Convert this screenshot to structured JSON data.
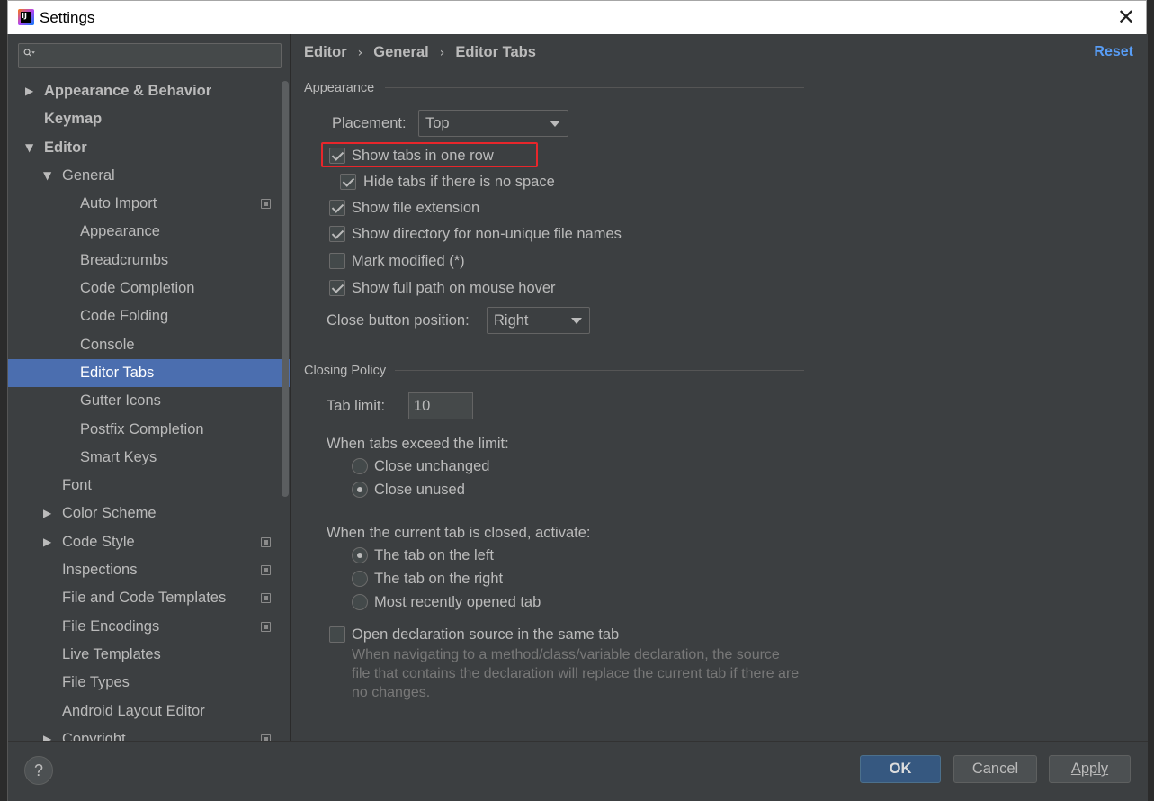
{
  "window": {
    "title": "Settings"
  },
  "search": {
    "placeholder": ""
  },
  "tree": [
    {
      "label": "Appearance & Behavior",
      "level": 0,
      "arrow": "▶",
      "bold": true,
      "selected": false,
      "project_icon": false
    },
    {
      "label": "Keymap",
      "level": 0,
      "arrow": "",
      "bold": true,
      "selected": false,
      "project_icon": false
    },
    {
      "label": "Editor",
      "level": 0,
      "arrow": "▼",
      "bold": true,
      "selected": false,
      "project_icon": false
    },
    {
      "label": "General",
      "level": 1,
      "arrow": "▼",
      "bold": false,
      "selected": false,
      "project_icon": false
    },
    {
      "label": "Auto Import",
      "level": 2,
      "arrow": "",
      "bold": false,
      "selected": false,
      "project_icon": true
    },
    {
      "label": "Appearance",
      "level": 2,
      "arrow": "",
      "bold": false,
      "selected": false,
      "project_icon": false
    },
    {
      "label": "Breadcrumbs",
      "level": 2,
      "arrow": "",
      "bold": false,
      "selected": false,
      "project_icon": false
    },
    {
      "label": "Code Completion",
      "level": 2,
      "arrow": "",
      "bold": false,
      "selected": false,
      "project_icon": false
    },
    {
      "label": "Code Folding",
      "level": 2,
      "arrow": "",
      "bold": false,
      "selected": false,
      "project_icon": false
    },
    {
      "label": "Console",
      "level": 2,
      "arrow": "",
      "bold": false,
      "selected": false,
      "project_icon": false
    },
    {
      "label": "Editor Tabs",
      "level": 2,
      "arrow": "",
      "bold": false,
      "selected": true,
      "project_icon": false
    },
    {
      "label": "Gutter Icons",
      "level": 2,
      "arrow": "",
      "bold": false,
      "selected": false,
      "project_icon": false
    },
    {
      "label": "Postfix Completion",
      "level": 2,
      "arrow": "",
      "bold": false,
      "selected": false,
      "project_icon": false
    },
    {
      "label": "Smart Keys",
      "level": 2,
      "arrow": "",
      "bold": false,
      "selected": false,
      "project_icon": false
    },
    {
      "label": "Font",
      "level": 1,
      "arrow": "",
      "bold": false,
      "selected": false,
      "project_icon": false
    },
    {
      "label": "Color Scheme",
      "level": 1,
      "arrow": "▶",
      "bold": false,
      "selected": false,
      "project_icon": false
    },
    {
      "label": "Code Style",
      "level": 1,
      "arrow": "▶",
      "bold": false,
      "selected": false,
      "project_icon": true
    },
    {
      "label": "Inspections",
      "level": 1,
      "arrow": "",
      "bold": false,
      "selected": false,
      "project_icon": true
    },
    {
      "label": "File and Code Templates",
      "level": 1,
      "arrow": "",
      "bold": false,
      "selected": false,
      "project_icon": true
    },
    {
      "label": "File Encodings",
      "level": 1,
      "arrow": "",
      "bold": false,
      "selected": false,
      "project_icon": true
    },
    {
      "label": "Live Templates",
      "level": 1,
      "arrow": "",
      "bold": false,
      "selected": false,
      "project_icon": false
    },
    {
      "label": "File Types",
      "level": 1,
      "arrow": "",
      "bold": false,
      "selected": false,
      "project_icon": false
    },
    {
      "label": "Android Layout Editor",
      "level": 1,
      "arrow": "",
      "bold": false,
      "selected": false,
      "project_icon": false
    },
    {
      "label": "Copyright",
      "level": 1,
      "arrow": "▶",
      "bold": false,
      "selected": false,
      "project_icon": true
    }
  ],
  "breadcrumb": {
    "items": [
      "Editor",
      "General",
      "Editor Tabs"
    ],
    "separator": "›"
  },
  "reset_label": "Reset",
  "appearance": {
    "title": "Appearance",
    "placement_label": "Placement:",
    "placement_value": "Top",
    "show_tabs_one_row": {
      "label": "Show tabs in one row",
      "checked": true
    },
    "hide_tabs_no_space": {
      "label": "Hide tabs if there is no space",
      "checked": true
    },
    "show_file_extension": {
      "label": "Show file extension",
      "checked": true
    },
    "show_directory": {
      "label": "Show directory for non-unique file names",
      "checked": true
    },
    "mark_modified": {
      "label": "Mark modified (*)",
      "checked": false
    },
    "show_full_path": {
      "label": "Show full path on mouse hover",
      "checked": true
    },
    "close_button_label": "Close button position:",
    "close_button_value": "Right"
  },
  "closing_policy": {
    "title": "Closing Policy",
    "tab_limit_label": "Tab limit:",
    "tab_limit_value": "10",
    "exceed_label": "When tabs exceed the limit:",
    "exceed_options": [
      {
        "label": "Close unchanged",
        "selected": false
      },
      {
        "label": "Close unused",
        "selected": true
      }
    ],
    "activate_label": "When the current tab is closed, activate:",
    "activate_options": [
      {
        "label": "The tab on the left",
        "selected": true
      },
      {
        "label": "The tab on the right",
        "selected": false
      },
      {
        "label": "Most recently opened tab",
        "selected": false
      }
    ],
    "open_declaration": {
      "label": "Open declaration source in the same tab",
      "checked": false
    },
    "open_declaration_hint": "When navigating to a method/class/variable declaration, the source file that contains the declaration will replace the current tab if there are no changes."
  },
  "buttons": {
    "help": "?",
    "ok": "OK",
    "cancel": "Cancel",
    "apply": "Apply"
  },
  "colors": {
    "selection": "#4b6eaf",
    "highlight_box": "#e8262b",
    "link": "#589df6",
    "primary_button": "#365880"
  }
}
